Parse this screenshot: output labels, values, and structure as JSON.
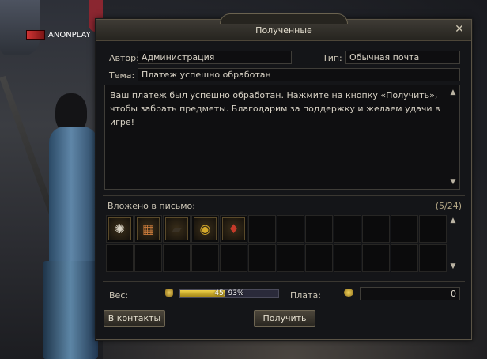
{
  "player": {
    "name": "ANONPLAY"
  },
  "window": {
    "title": "Полученные",
    "close_glyph": "✕"
  },
  "mail": {
    "author_label": "Автор:",
    "author_value": "Администрация",
    "type_label": "Тип:",
    "type_value": "Обычная почта",
    "subject_label": "Тема:",
    "subject_value": "Платеж успешно обработан",
    "body": "Ваш платеж был успешно обработан. Нажмите на кнопку «Получить», чтобы забрать предметы. Благодарим за поддержку и желаем удачи в игре!"
  },
  "attachments": {
    "label": "Вложено в письмо:",
    "count": "(5/24)",
    "items": [
      {
        "icon": "scroll-icon",
        "color": "#d9d3c6"
      },
      {
        "icon": "chest-icon",
        "color": "#c97a3a"
      },
      {
        "icon": "ticket-icon",
        "color": "#3a3226"
      },
      {
        "icon": "coin-icon",
        "color": "#d4a92a"
      },
      {
        "icon": "potion-icon",
        "color": "#c43a2a"
      }
    ],
    "total_slots": 24
  },
  "footer": {
    "weight_label": "Вес:",
    "weight_text": "45, 93%",
    "weight_fraction": 0.4593,
    "payment_label": "Плата:",
    "payment_value": "0"
  },
  "buttons": {
    "contacts": "В контакты",
    "receive": "Получить"
  }
}
